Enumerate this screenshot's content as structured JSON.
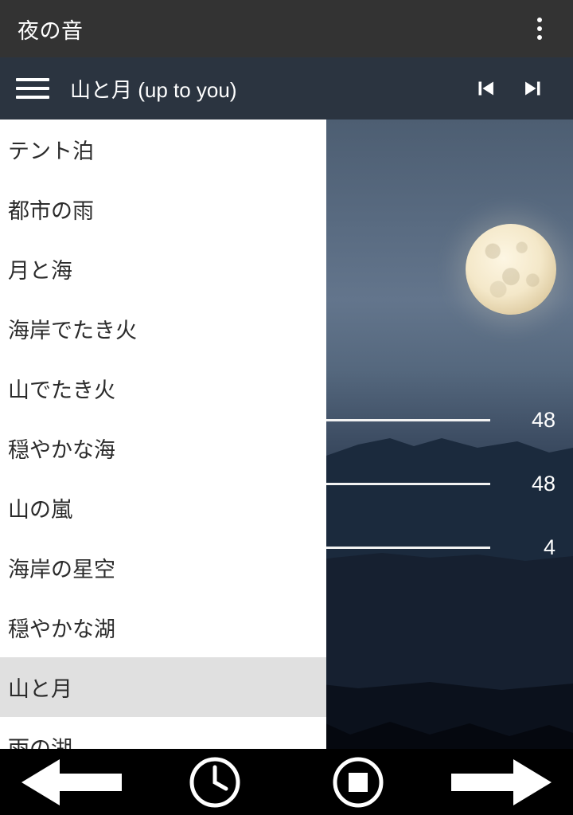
{
  "appbar": {
    "title": "夜の音",
    "overflow_icon": "more-vert-icon"
  },
  "playerbar": {
    "menu_icon": "hamburger-menu-icon",
    "track_title": "山と月 (up to you)",
    "prev_icon": "skip-previous-icon",
    "next_icon": "skip-next-icon"
  },
  "mixer": {
    "rows": [
      {
        "value": "48"
      },
      {
        "value": "48"
      },
      {
        "value": "4"
      }
    ]
  },
  "drawer": {
    "items": [
      {
        "label": "テント泊",
        "selected": false
      },
      {
        "label": "都市の雨",
        "selected": false
      },
      {
        "label": "月と海",
        "selected": false
      },
      {
        "label": "海岸でたき火",
        "selected": false
      },
      {
        "label": "山でたき火",
        "selected": false
      },
      {
        "label": "穏やかな海",
        "selected": false
      },
      {
        "label": "山の嵐",
        "selected": false
      },
      {
        "label": "海岸の星空",
        "selected": false
      },
      {
        "label": "穏やかな湖",
        "selected": false
      },
      {
        "label": "山と月",
        "selected": true
      },
      {
        "label": "雨の湖",
        "selected": false
      }
    ]
  },
  "bottombar": {
    "back_icon": "back-arrow-icon",
    "timer_icon": "clock-icon",
    "stop_icon": "stop-square-icon",
    "forward_icon": "forward-arrow-icon"
  },
  "colors": {
    "appbar_bg": "#333333",
    "playerbar_bg": "#2b3440",
    "drawer_bg": "#ffffff",
    "drawer_selected_bg": "#e0e0e0",
    "bottombar_bg": "#000000",
    "text_light": "#ffffff",
    "text_dark": "#2b2b2b"
  }
}
